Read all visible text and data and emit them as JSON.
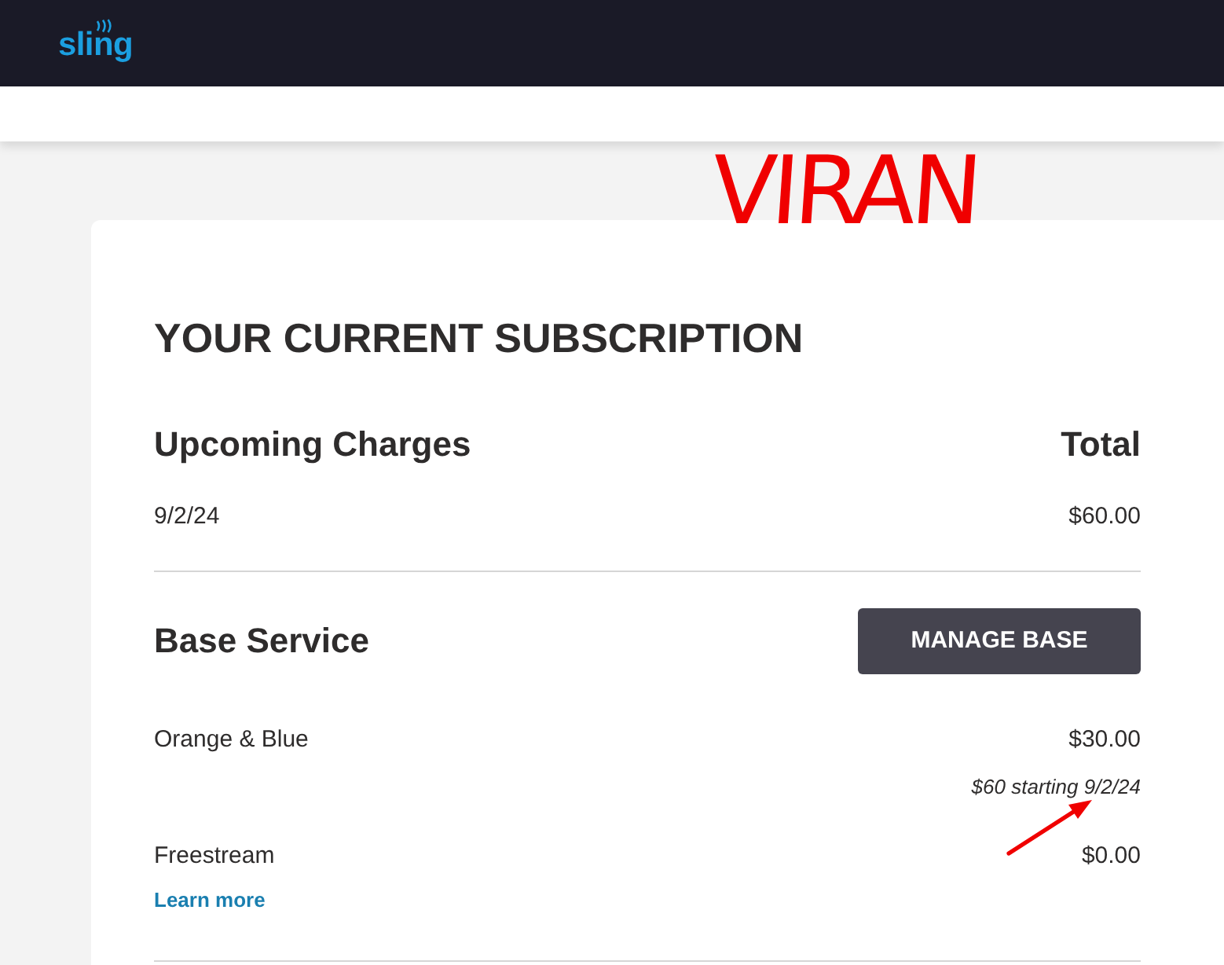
{
  "header": {
    "logo": "sling"
  },
  "subscription": {
    "title": "YOUR CURRENT SUBSCRIPTION",
    "upcoming": {
      "heading": "Upcoming Charges",
      "total_heading": "Total",
      "rows": [
        {
          "date": "9/2/24",
          "amount": "$60.00"
        }
      ]
    },
    "base_service": {
      "heading": "Base Service",
      "button": "MANAGE BASE",
      "items": [
        {
          "name": "Orange & Blue",
          "price": "$30.00",
          "note": "$60 starting 9/2/24"
        },
        {
          "name": "Freestream",
          "price": "$0.00",
          "link": "Learn more"
        }
      ]
    }
  },
  "annotations": {
    "handwriting": "VIRAN"
  }
}
